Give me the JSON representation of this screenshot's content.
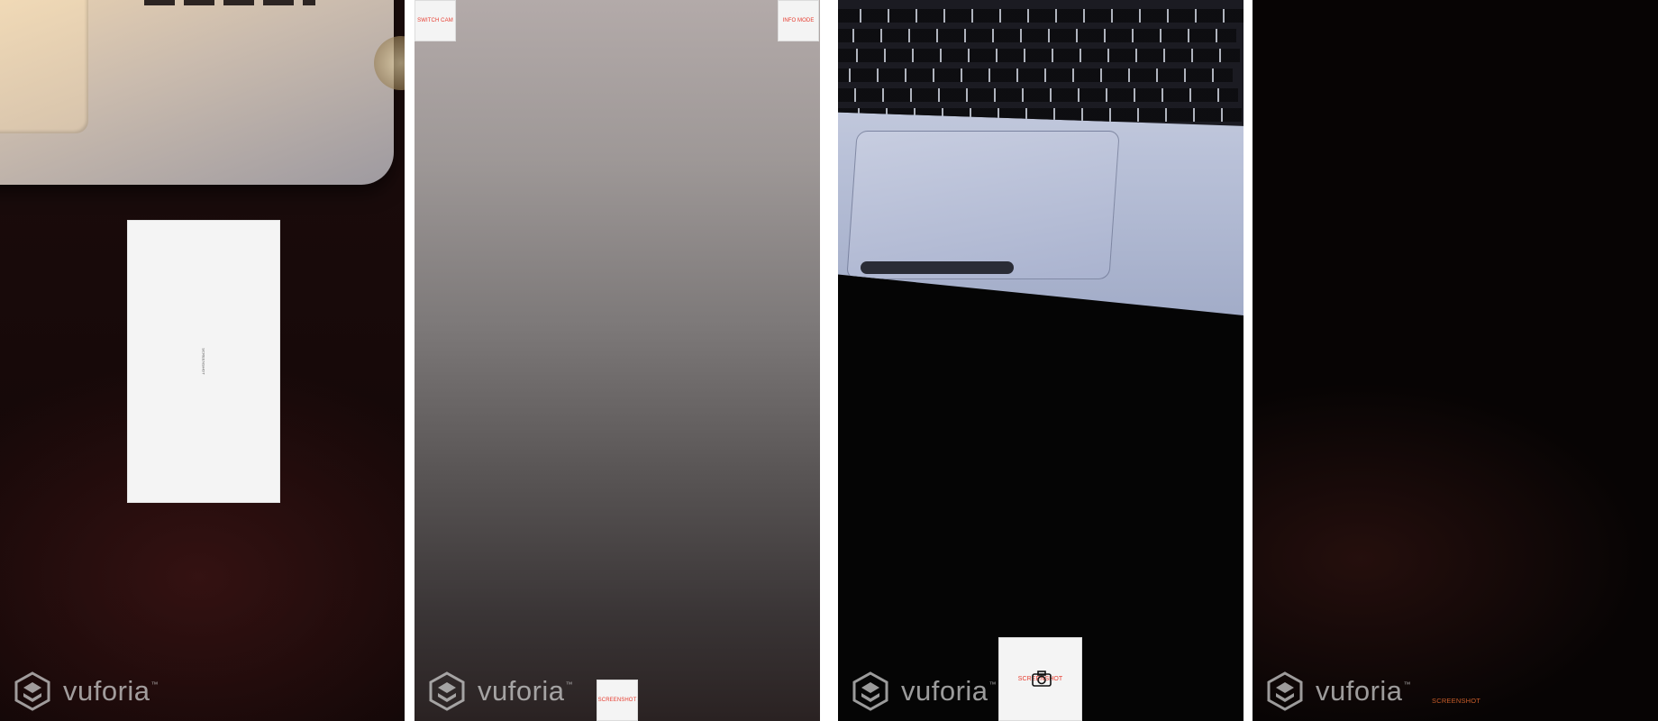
{
  "panels": [
    {
      "id": "p1",
      "card_label": "SCREENSHOT",
      "watermark": {
        "word": "vuforia",
        "tm": "™"
      }
    },
    {
      "id": "p2",
      "switch_cam": "SWITCH CAM",
      "info_mode": "INFO MODE",
      "screenshot": "SCREENSHOT",
      "watermark": {
        "word": "vuforia",
        "tm": "™"
      }
    },
    {
      "id": "p3",
      "screenshot": "SCREENSHOT",
      "camera_icon": "camera-icon",
      "watermark": {
        "word": "vuforia",
        "tm": "™"
      }
    },
    {
      "id": "p4",
      "screenshot": "SCREENSHOT",
      "watermark": {
        "word": "vuforia",
        "tm": "™"
      }
    }
  ],
  "colors": {
    "button_text": "#e63b2e",
    "button_bg": "#f4f4f4",
    "watermark": "#cdcdcd",
    "orange_text": "#c95d2a"
  }
}
